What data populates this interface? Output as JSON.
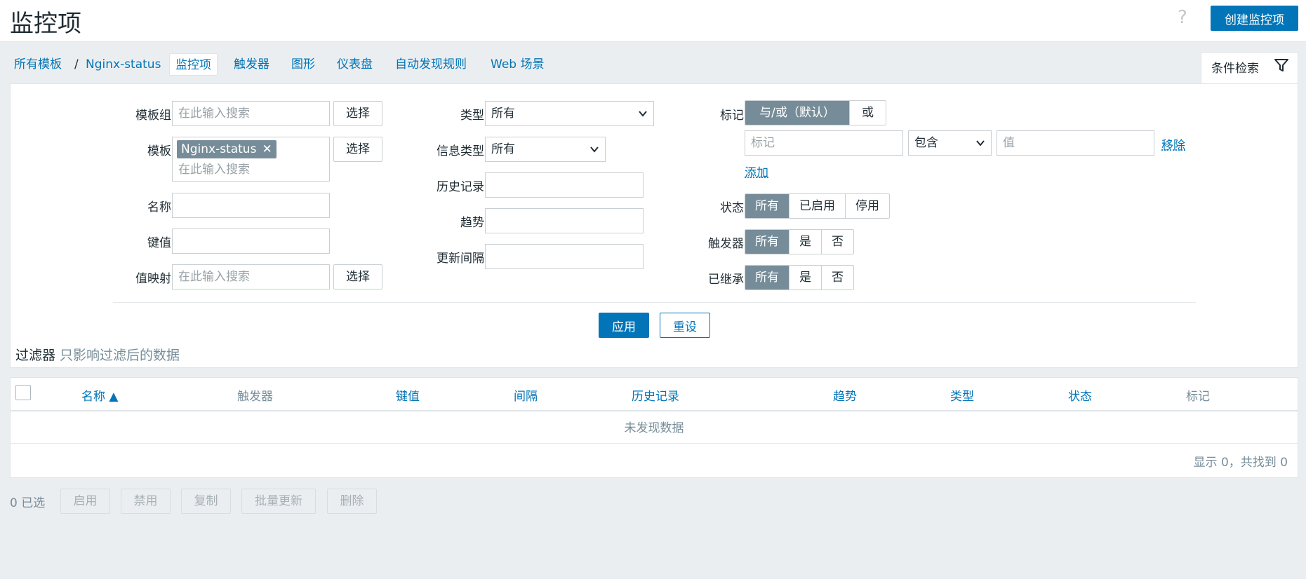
{
  "header": {
    "title": "监控项",
    "help": "?",
    "create_label": "创建监控项"
  },
  "nav": {
    "all_templates": "所有模板",
    "separator": "/",
    "template": "Nginx-status",
    "tabs": [
      "监控项",
      "触发器",
      "图形",
      "仪表盘",
      "自动发现规则",
      "Web 场景"
    ]
  },
  "filter_tab": {
    "label": "条件检索"
  },
  "filter": {
    "template_group": {
      "label": "模板组",
      "placeholder": "在此输入搜索",
      "select": "选择"
    },
    "template": {
      "label": "模板",
      "chip": "Nginx-status",
      "chip_close": "✕",
      "placeholder": "在此输入搜索",
      "select": "选择"
    },
    "name": {
      "label": "名称",
      "value": ""
    },
    "key": {
      "label": "键值",
      "value": ""
    },
    "value_map": {
      "label": "值映射",
      "placeholder": "在此输入搜索",
      "select": "选择"
    },
    "type": {
      "label": "类型",
      "value": "所有"
    },
    "info_type": {
      "label": "信息类型",
      "value": "所有"
    },
    "history": {
      "label": "历史记录",
      "value": ""
    },
    "trends": {
      "label": "趋势",
      "value": ""
    },
    "interval": {
      "label": "更新间隔",
      "value": ""
    },
    "tags": {
      "label": "标记",
      "ops": [
        "与/或（默认）",
        "或"
      ],
      "tag_placeholder": "标记",
      "operator": "包含",
      "value_placeholder": "值",
      "remove": "移除",
      "add": "添加"
    },
    "state": {
      "label": "状态",
      "options": [
        "所有",
        "已启用",
        "停用"
      ]
    },
    "with_triggers": {
      "label": "触发器",
      "options": [
        "所有",
        "是",
        "否"
      ]
    },
    "inherited": {
      "label": "已继承",
      "options": [
        "所有",
        "是",
        "否"
      ]
    },
    "apply": "应用",
    "reset": "重设",
    "note_bold": "过滤器",
    "note_gray": "只影响过滤后的数据"
  },
  "table": {
    "columns": [
      "名称 ▲",
      "触发器",
      "键值",
      "间隔",
      "历史记录",
      "趋势",
      "类型",
      "状态",
      "标记"
    ],
    "empty": "未发现数据",
    "count": "显示 0，共找到 0"
  },
  "actions": {
    "selected": "0 已选",
    "buttons": [
      "启用",
      "禁用",
      "复制",
      "批量更新",
      "删除"
    ]
  },
  "colors": {
    "accent": "#0275b8",
    "segment_on": "#768d99",
    "background": "#ebeef0"
  }
}
